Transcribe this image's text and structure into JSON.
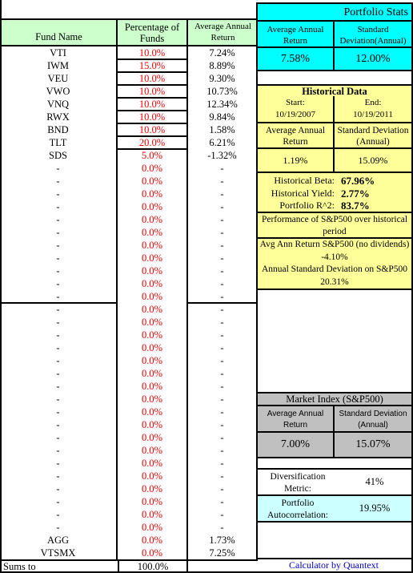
{
  "fund_table": {
    "headers": {
      "fund_name": "Fund Name",
      "percentage": "Percentage of Funds",
      "avg_return": "Average Annual Return"
    },
    "rows": [
      {
        "name": "VTI",
        "pct": "10.0%",
        "ret": "7.24%"
      },
      {
        "name": "IWM",
        "pct": "15.0%",
        "ret": "8.89%"
      },
      {
        "name": "VEU",
        "pct": "10.0%",
        "ret": "9.30%"
      },
      {
        "name": "VWO",
        "pct": "10.0%",
        "ret": "10.73%"
      },
      {
        "name": "VNQ",
        "pct": "10.0%",
        "ret": "12.34%"
      },
      {
        "name": "RWX",
        "pct": "10.0%",
        "ret": "9.84%"
      },
      {
        "name": "BND",
        "pct": "10.0%",
        "ret": "1.58%"
      },
      {
        "name": "TLT",
        "pct": "20.0%",
        "ret": "6.21%"
      },
      {
        "name": "SDS",
        "pct": "5.0%",
        "ret": "-1.32%"
      },
      {
        "name": "-",
        "pct": "0.0%",
        "ret": "-"
      },
      {
        "name": "-",
        "pct": "0.0%",
        "ret": "-"
      },
      {
        "name": "-",
        "pct": "0.0%",
        "ret": "-"
      },
      {
        "name": "-",
        "pct": "0.0%",
        "ret": "-"
      },
      {
        "name": "-",
        "pct": "0.0%",
        "ret": "-"
      },
      {
        "name": "-",
        "pct": "0.0%",
        "ret": "-"
      },
      {
        "name": "-",
        "pct": "0.0%",
        "ret": "-"
      },
      {
        "name": "-",
        "pct": "0.0%",
        "ret": "-"
      },
      {
        "name": "-",
        "pct": "0.0%",
        "ret": "-"
      },
      {
        "name": "-",
        "pct": "0.0%",
        "ret": "-"
      },
      {
        "name": "-",
        "pct": "0.0%",
        "ret": "-"
      },
      {
        "name": "-",
        "pct": "0.0%",
        "ret": "-"
      },
      {
        "name": "-",
        "pct": "0.0%",
        "ret": "-"
      },
      {
        "name": "-",
        "pct": "0.0%",
        "ret": "-"
      },
      {
        "name": "-",
        "pct": "0.0%",
        "ret": "-"
      },
      {
        "name": "-",
        "pct": "0.0%",
        "ret": "-"
      },
      {
        "name": "-",
        "pct": "0.0%",
        "ret": "-"
      },
      {
        "name": "-",
        "pct": "0.0%",
        "ret": "-"
      },
      {
        "name": "-",
        "pct": "0.0%",
        "ret": "-"
      },
      {
        "name": "-",
        "pct": "0.0%",
        "ret": "-"
      },
      {
        "name": "-",
        "pct": "0.0%",
        "ret": "-"
      },
      {
        "name": "-",
        "pct": "0.0%",
        "ret": "-"
      },
      {
        "name": "-",
        "pct": "0.0%",
        "ret": "-"
      },
      {
        "name": "-",
        "pct": "0.0%",
        "ret": "-"
      },
      {
        "name": "-",
        "pct": "0.0%",
        "ret": "-"
      },
      {
        "name": "-",
        "pct": "0.0%",
        "ret": "-"
      },
      {
        "name": "-",
        "pct": "0.0%",
        "ret": "-"
      },
      {
        "name": "-",
        "pct": "0.0%",
        "ret": "-"
      },
      {
        "name": "-",
        "pct": "0.0%",
        "ret": "-"
      },
      {
        "name": "AGG",
        "pct": "0.0%",
        "ret": "1.73%"
      },
      {
        "name": "VTSMX",
        "pct": "0.0%",
        "ret": "7.25%"
      }
    ],
    "sums_label": "Sums to",
    "sums_value": "100.0%"
  },
  "portfolio_stats": {
    "title": "Portfolio Stats",
    "avg_return_label": "Average Annual Return",
    "std_dev_label": "Standard Deviation(Annual)",
    "avg_return": "7.58%",
    "std_dev": "12.00%"
  },
  "historical": {
    "title": "Historical Data",
    "start_label": "Start:",
    "start_date": "10/19/2007",
    "end_label": "End:",
    "end_date": "10/19/2011",
    "avg_return_label": "Average Annual Return",
    "std_dev_label": "Standard Deviation (Annual)",
    "avg_return": "1.19%",
    "std_dev": "15.09%",
    "metrics": [
      {
        "label": "Historical Beta:",
        "value": "67.96%"
      },
      {
        "label": "Historical Yield:",
        "value": "2.77%"
      },
      {
        "label": "Portfolio R^2:",
        "value": "83.7%"
      }
    ],
    "sp_perf_title": "Performance of S&P500 over historical period",
    "sp_avg_label": "Avg Ann Return S&P500 (no dividends)",
    "sp_avg_value": "-4.10%",
    "sp_std_label": "Annual Standard Deviation on S&P500",
    "sp_std_value": "20.31%"
  },
  "market_index": {
    "title": "Market Index (S&P500)",
    "avg_return_label": "Average Annual Return",
    "std_dev_label": "Standard Deviation (Annual)",
    "avg_return": "7.00%",
    "std_dev": "15.07%"
  },
  "diversification": {
    "label": "Diversification Metric:",
    "value": "41%"
  },
  "autocorrelation": {
    "label": "Portfolio Autocorrelation:",
    "value": "19.95%"
  },
  "credit": "Calculator by Quantext",
  "colors": {
    "header_green": "#ccffcc",
    "portfolio_cyan": "#00ffff",
    "historical_yellow": "#ffff99",
    "market_gray": "#c0c0c0",
    "autocorr_lightcyan": "#ccffff",
    "allocation_red": "#ff0000",
    "credit_blue": "#0000cc"
  }
}
